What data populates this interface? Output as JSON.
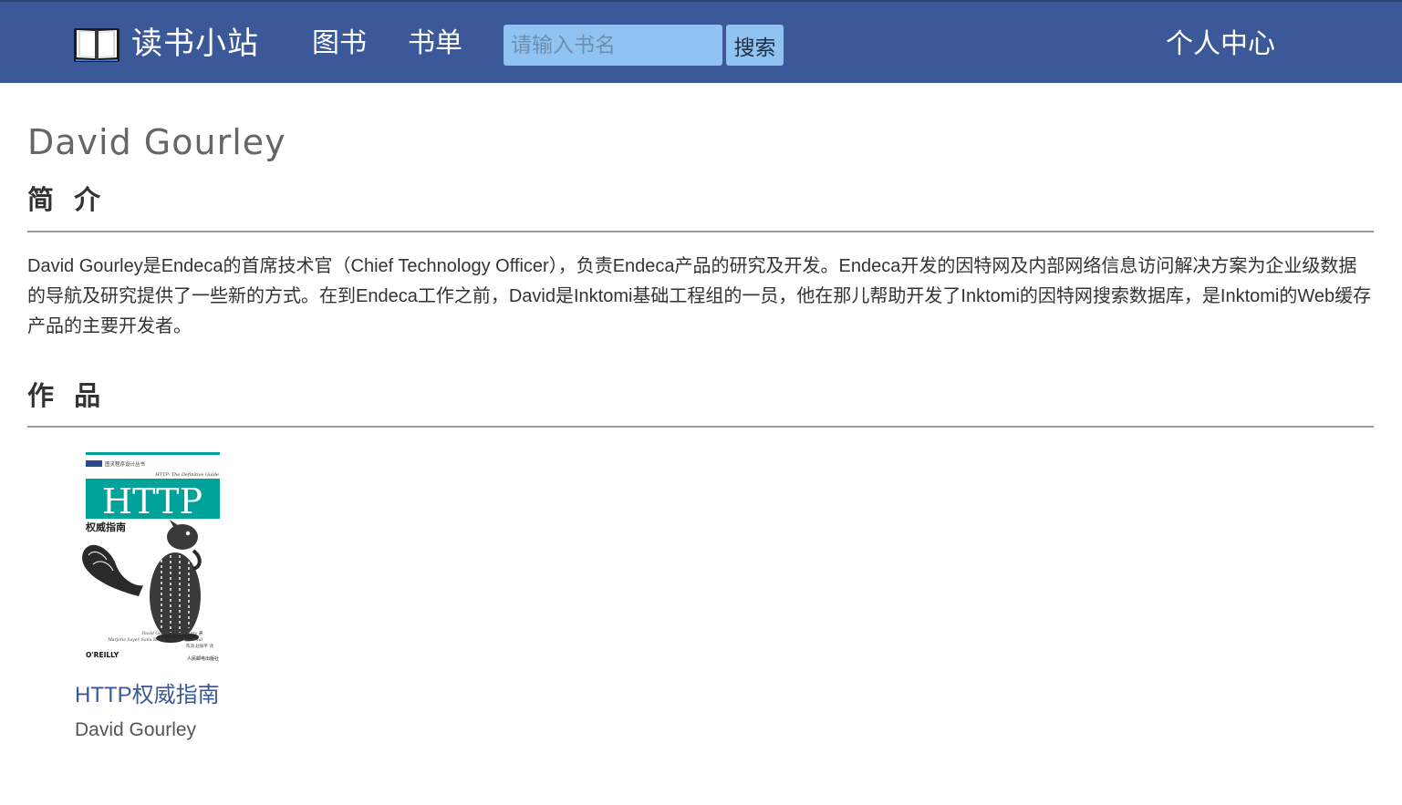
{
  "navbar": {
    "brand_icon": "open-book-icon",
    "brand_text": "读书小站",
    "links": [
      {
        "label": "图书"
      },
      {
        "label": "书单"
      }
    ],
    "search": {
      "placeholder": "请输入书名",
      "value": "",
      "button_label": "搜索"
    },
    "profile_label": "个人中心",
    "colors": {
      "background": "#3b5998",
      "search_field": "#90c2f2"
    }
  },
  "author": {
    "name": "David Gourley"
  },
  "intro": {
    "heading": "简 介",
    "text": "David Gourley是Endeca的首席技术官（Chief Technology Officer），负责Endeca产品的研究及开发。Endeca开发的因特网及内部网络信息访问解决方案为企业级数据的导航及研究提供了一些新的方式。在到Endeca工作之前，David是Inktomi基础工程组的一员，他在那儿帮助开发了Inktomi的因特网搜索数据库，是Inktomi的Web缓存产品的主要开发者。"
  },
  "works": {
    "heading": "作 品",
    "books": [
      {
        "title": "HTTP权威指南",
        "author": "David Gourley",
        "cover": {
          "series_label": "图灵程序设计丛书",
          "english_title": "HTTP: The Definitive Guide",
          "big_title": "HTTP",
          "chinese_title": "权威指南",
          "authors_line1": "David Gourley, Brian Totty 著",
          "authors_line2": "Marjorie Sayer, Sailu Reddy, Anshu Aggarwal",
          "translators": "陈涓 赵振平 译",
          "publisher_left": "O'REILLY",
          "publisher_right": "人民邮电出版社",
          "teal_color": "#00a29a"
        }
      }
    ]
  }
}
